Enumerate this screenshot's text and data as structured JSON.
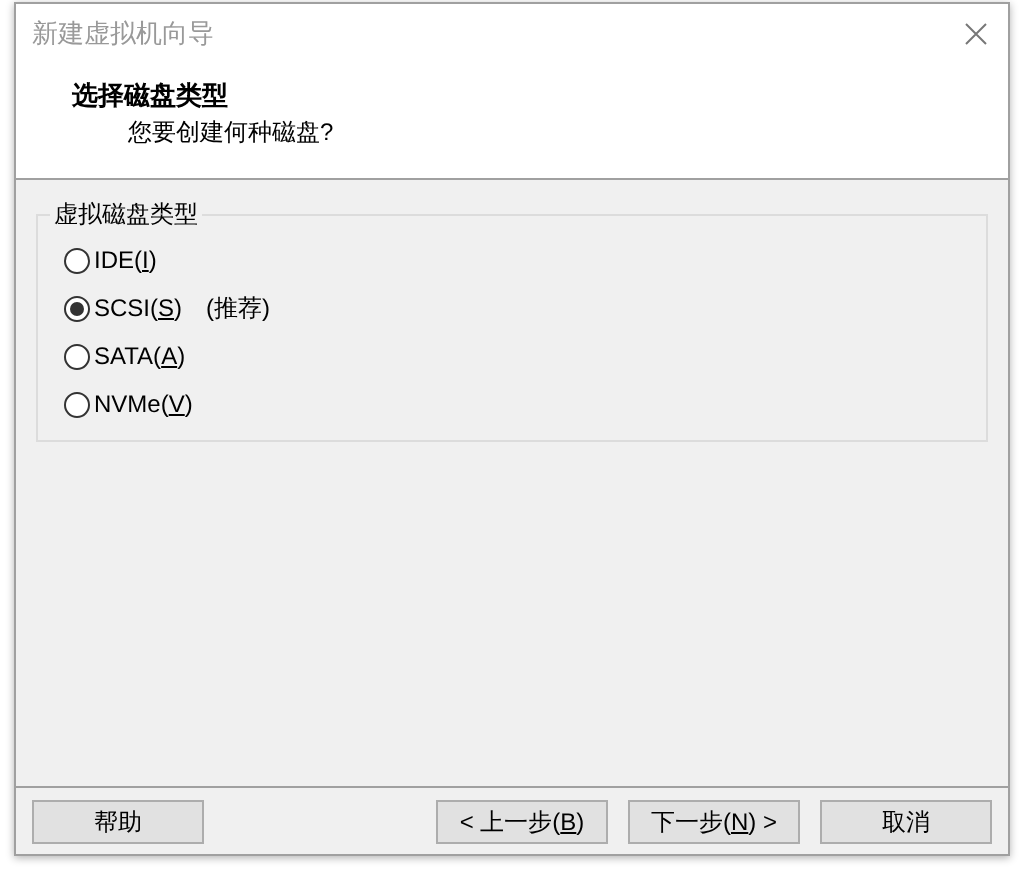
{
  "window": {
    "title": "新建虚拟机向导"
  },
  "header": {
    "title": "选择磁盘类型",
    "subtitle": "您要创建何种磁盘?"
  },
  "group": {
    "title": "虚拟磁盘类型",
    "options": [
      {
        "label_before": "IDE(",
        "accel": "I",
        "label_after": ")",
        "selected": false
      },
      {
        "label_before": "SCSI(",
        "accel": "S",
        "label_after": ")",
        "note": "(推荐)",
        "selected": true
      },
      {
        "label_before": "SATA(",
        "accel": "A",
        "label_after": ")",
        "selected": false
      },
      {
        "label_before": "NVMe(",
        "accel": "V",
        "label_after": ")",
        "selected": false
      }
    ]
  },
  "buttons": [
    {
      "kind": "help",
      "label_before": "帮助"
    },
    {
      "kind": "nav",
      "label_before": "< 上一步(",
      "accel": "B",
      "label_after": ")"
    },
    {
      "kind": "nav",
      "label_before": "下一步(",
      "accel": "N",
      "label_after": ") >"
    },
    {
      "kind": "nav",
      "label_before": "取消"
    }
  ]
}
